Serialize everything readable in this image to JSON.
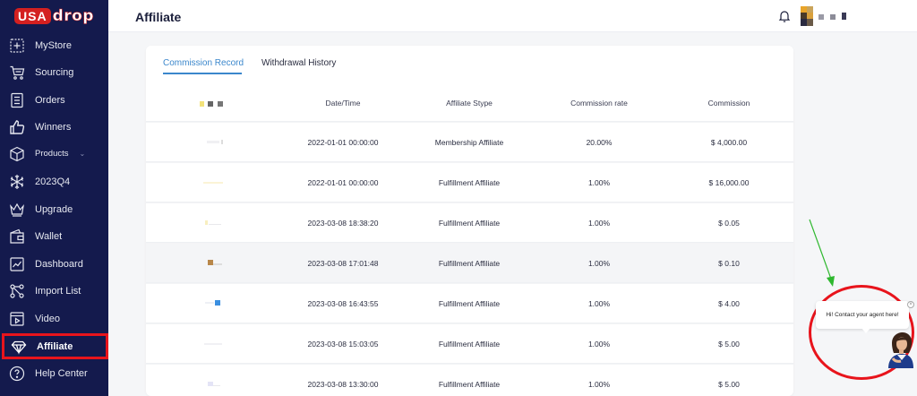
{
  "app": {
    "logo_usa": "USA",
    "logo_drop": "drop",
    "page_title": "Affiliate"
  },
  "sidebar": {
    "items": [
      {
        "label": "MyStore",
        "icon": "store-icon"
      },
      {
        "label": "Sourcing",
        "icon": "cart-icon"
      },
      {
        "label": "Orders",
        "icon": "orders-icon"
      },
      {
        "label": "Winners",
        "icon": "thumbs-up-icon"
      },
      {
        "label": "Products",
        "icon": "box-icon"
      },
      {
        "label": "2023Q4",
        "icon": "snowflake-icon"
      },
      {
        "label": "Upgrade",
        "icon": "crown-icon"
      },
      {
        "label": "Wallet",
        "icon": "wallet-icon"
      },
      {
        "label": "Dashboard",
        "icon": "chart-icon"
      },
      {
        "label": "Import List",
        "icon": "network-icon"
      },
      {
        "label": "Video",
        "icon": "video-icon"
      },
      {
        "label": "Affiliate",
        "icon": "diamond-icon"
      },
      {
        "label": "Help Center",
        "icon": "help-icon"
      }
    ],
    "active": "Affiliate"
  },
  "tabs": [
    {
      "label": "Commission Record",
      "active": true
    },
    {
      "label": "Withdrawal History",
      "active": false
    }
  ],
  "table": {
    "columns": [
      "Date/Time",
      "Affiliate Stype",
      "Commission rate",
      "Commission"
    ],
    "rows": [
      {
        "date": "2022-01-01 00:00:00",
        "type": "Membership Affiliate",
        "rate": "20.00%",
        "commission": "$ 4,000.00"
      },
      {
        "date": "2022-01-01 00:00:00",
        "type": "Fulfillment Affiliate",
        "rate": "1.00%",
        "commission": "$ 16,000.00"
      },
      {
        "date": "2023-03-08 18:38:20",
        "type": "Fulfillment Affiliate",
        "rate": "1.00%",
        "commission": "$ 0.05"
      },
      {
        "date": "2023-03-08 17:01:48",
        "type": "Fulfillment Affiliate",
        "rate": "1.00%",
        "commission": "$ 0.10"
      },
      {
        "date": "2023-03-08 16:43:55",
        "type": "Fulfillment Affiliate",
        "rate": "1.00%",
        "commission": "$ 4.00"
      },
      {
        "date": "2023-03-08 15:03:05",
        "type": "Fulfillment Affiliate",
        "rate": "1.00%",
        "commission": "$ 5.00"
      },
      {
        "date": "2023-03-08 13:30:00",
        "type": "Fulfillment Affiliate",
        "rate": "1.00%",
        "commission": "$ 5.00"
      }
    ]
  },
  "chat": {
    "bubble_text": "Hi! Contact your agent here!",
    "close_symbol": "×"
  },
  "colors": {
    "sidebar_bg": "#141a4d",
    "accent_blue": "#3b87cc",
    "highlight_red": "#e8141c",
    "arrow_green": "#2fb82f"
  }
}
